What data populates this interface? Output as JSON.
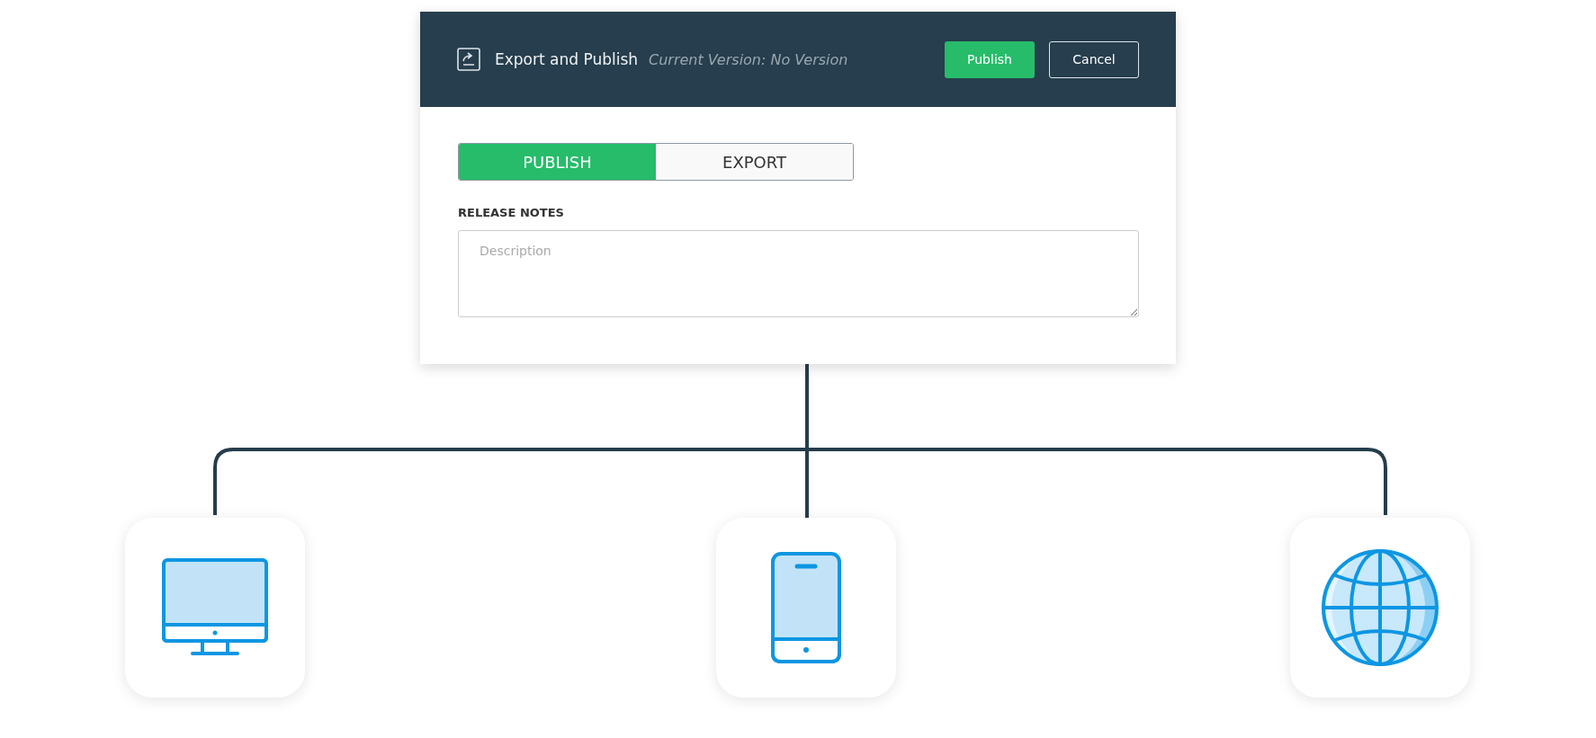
{
  "dialog": {
    "title": "Export and Publish",
    "version": "Current Version: No Version",
    "buttons": [
      {
        "label": "Publish",
        "kind": "primary"
      },
      {
        "label": "Cancel",
        "kind": "secondary"
      }
    ],
    "tabs": [
      {
        "label": "PUBLISH",
        "selected": true
      },
      {
        "label": "EXPORT",
        "selected": false
      }
    ],
    "release_notes": {
      "label": "RELEASE NOTES",
      "placeholder": "Description"
    }
  },
  "targets": [
    {
      "kind": "desktop"
    },
    {
      "kind": "phone"
    },
    {
      "kind": "globe"
    }
  ]
}
